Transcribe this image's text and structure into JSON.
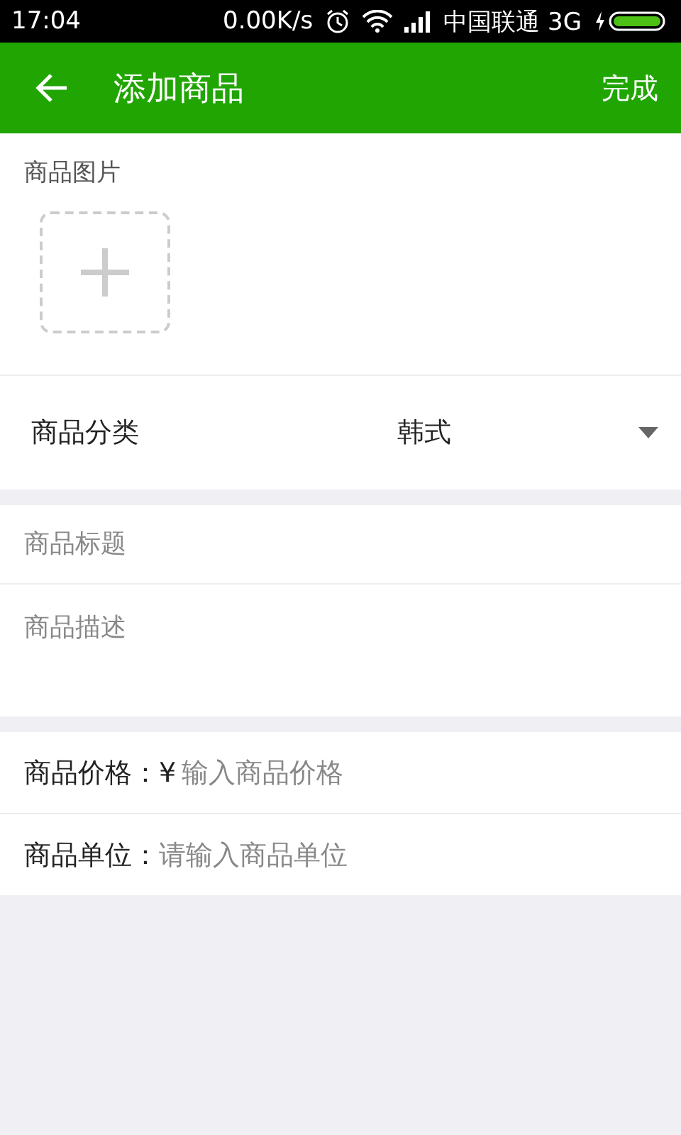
{
  "status_bar": {
    "time": "17:04",
    "speed": "0.00K/s",
    "carrier": "中国联通 3G"
  },
  "app_bar": {
    "title": "添加商品",
    "action": "完成"
  },
  "image_section": {
    "label": "商品图片"
  },
  "category": {
    "label": "商品分类",
    "value": "韩式"
  },
  "title_field": {
    "placeholder": "商品标题"
  },
  "description_field": {
    "placeholder": "商品描述"
  },
  "price": {
    "label": "商品价格：",
    "prefix": "¥",
    "placeholder": "输入商品价格"
  },
  "unit": {
    "label": "商品单位：",
    "placeholder": "请输入商品单位"
  }
}
